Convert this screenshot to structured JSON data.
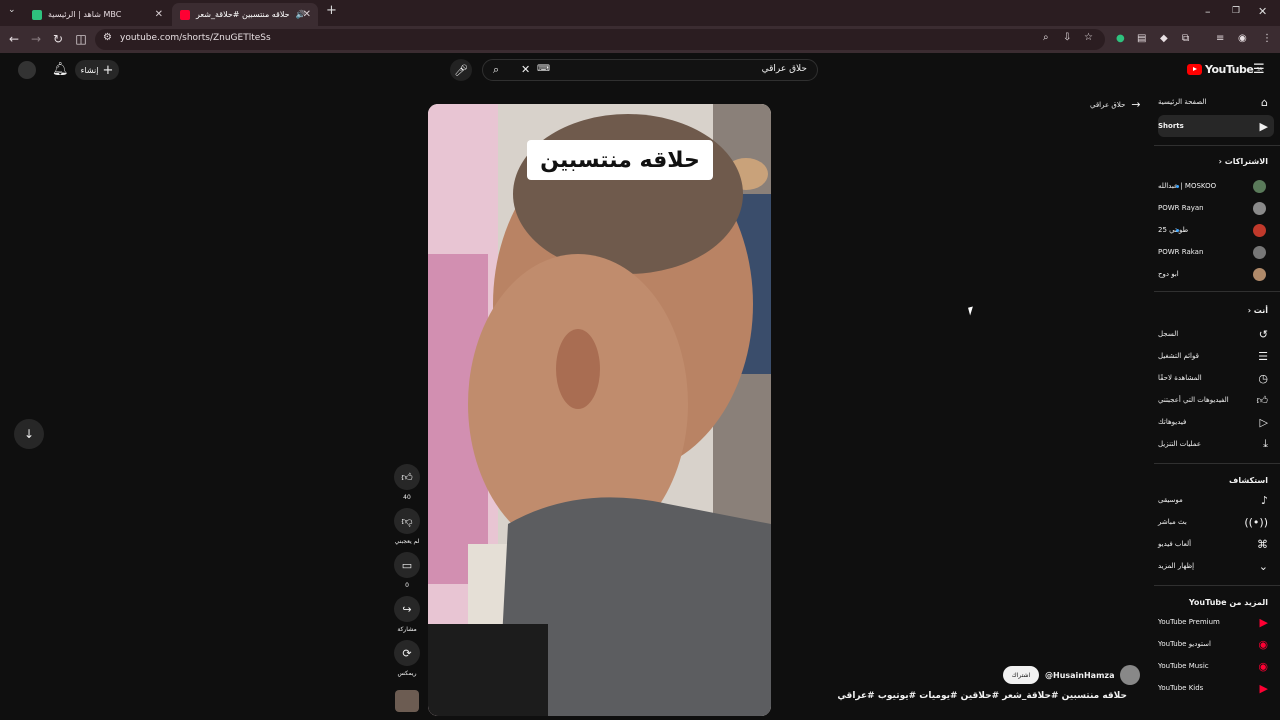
{
  "browser": {
    "tabs": [
      {
        "title": "شاهد | الرئيسية MBC",
        "favicon_color": "#2ec27e",
        "active": false
      },
      {
        "title": "حلاقه منتسبين #حلاقة_شعر",
        "favicon_color": "#ff0033",
        "active": true
      }
    ],
    "url": "youtube.com/shorts/ZnuGETlteSs"
  },
  "header": {
    "create_label": "إنشاء",
    "search_query": "حلاق عراقي",
    "logo_text": "YouTube",
    "logo_region": "SA"
  },
  "back_link": "حلاق عراقي",
  "sidebar": {
    "home": "الصفحة الرئيسية",
    "shorts": "Shorts",
    "subs_heading": "الاشتراكات",
    "subs": [
      {
        "name": "MOSKOO | عبدالله",
        "color": "#5a7a5a",
        "dot": true
      },
      {
        "name": "POWR Rayan",
        "color": "#8a8a8a",
        "dot": false
      },
      {
        "name": "طوبتي 25",
        "color": "#c0392b",
        "dot": true
      },
      {
        "name": "POWR Rakan",
        "color": "#777777",
        "dot": false
      },
      {
        "name": "ابو دوح",
        "color": "#b08a6a",
        "dot": false
      }
    ],
    "you_heading": "أنت",
    "you_items": [
      {
        "label": "السجل",
        "icon": "history-icon"
      },
      {
        "label": "قوائم التشغيل",
        "icon": "playlist-icon"
      },
      {
        "label": "المشاهدة لاحقًا",
        "icon": "clock-icon"
      },
      {
        "label": "الفيديوهات التي أعجبتني",
        "icon": "like-icon"
      },
      {
        "label": "فيديوهاتك",
        "icon": "video-icon"
      },
      {
        "label": "عمليات التنزيل",
        "icon": "download-icon"
      }
    ],
    "explore_heading": "استكشاف",
    "explore_items": [
      {
        "label": "موسيقى",
        "icon": "music-icon"
      },
      {
        "label": "بث مباشر",
        "icon": "live-icon"
      },
      {
        "label": "ألعاب فيديو",
        "icon": "gaming-icon"
      },
      {
        "label": "إظهار المزيد",
        "icon": "chevron-down-icon"
      }
    ],
    "more_heading": "المزيد من YouTube",
    "more_items": [
      {
        "label": "YouTube Premium"
      },
      {
        "label": "استوديو YouTube"
      },
      {
        "label": "YouTube Music"
      },
      {
        "label": "YouTube Kids"
      }
    ]
  },
  "short": {
    "caption": "حلاقه منتسبين",
    "channel": "@HusainHamza",
    "subscribe": "اشتراك",
    "title": "حلاقه منتسبين #حلاقة_شعر #حلاقين #يوميات #يوتيوب #عراقي",
    "likes": "40",
    "dislike_label": "لم يعجبني",
    "comments": "0",
    "share_label": "مشاركة",
    "remix_label": "ريمكس"
  }
}
